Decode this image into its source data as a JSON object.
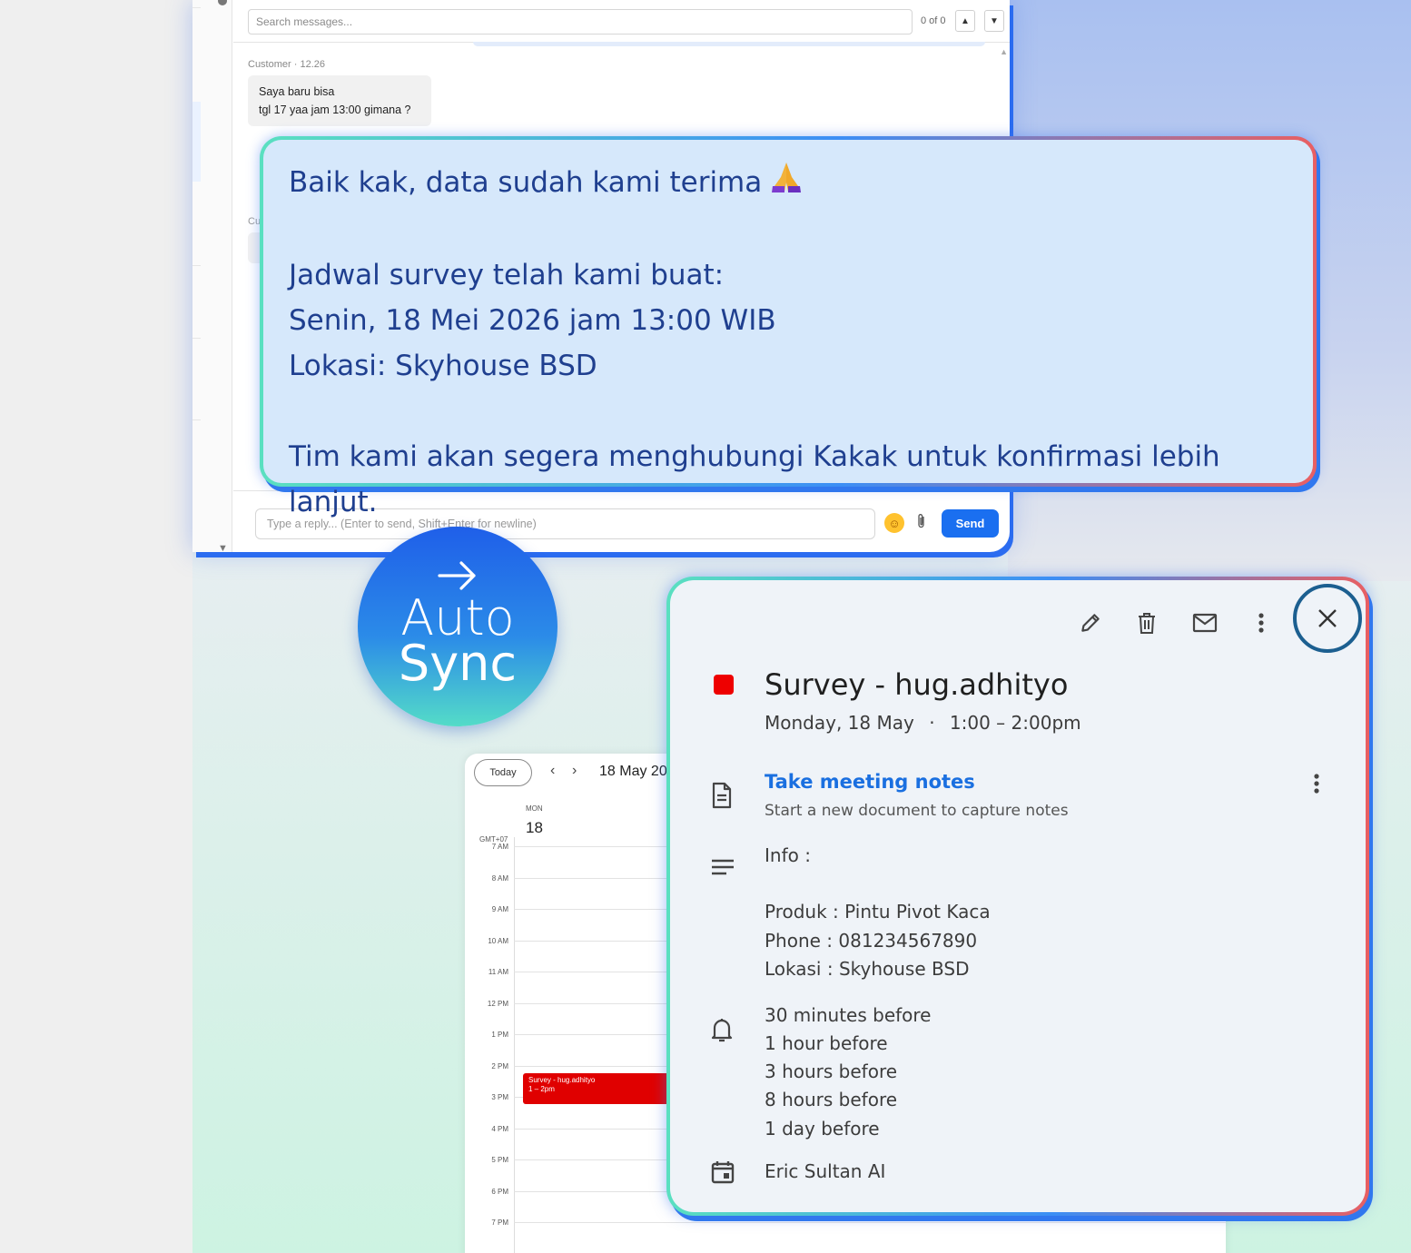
{
  "chat": {
    "search_placeholder": "Search messages...",
    "search_count": "0 of 0",
    "message": {
      "meta": "Customer · 12.26",
      "lines": [
        "Saya baru bisa",
        "tgl 17 yaa jam 13:00 gimana ?"
      ]
    },
    "ghost_meta": "Cu",
    "reply_placeholder": "Type a reply... (Enter to send, Shift+Enter for newline)",
    "send_label": "Send"
  },
  "reply_message": {
    "line1": "Baik kak, data sudah kami terima",
    "line2": "Jadwal survey telah kami buat:",
    "line3": "Senin, 18 Mei 2026 jam 13:00 WIB",
    "line4": "Lokasi: Skyhouse BSD",
    "line5": "Tim kami akan segera menghubungi Kakak untuk konfirmasi lebih lanjut."
  },
  "badge": {
    "word1": "Auto",
    "word2": "Sync"
  },
  "calendar": {
    "today_label": "Today",
    "date_label": "18 May 20",
    "day_of_week": "MON",
    "day_number": "18",
    "timezone": "GMT+07",
    "hours": [
      "7 AM",
      "8 AM",
      "9 AM",
      "10 AM",
      "11 AM",
      "12 PM",
      "1 PM",
      "2 PM",
      "3 PM",
      "4 PM",
      "5 PM",
      "6 PM",
      "7 PM"
    ],
    "event": {
      "title": "Survey - hug.adhityo",
      "time": "1 – 2pm",
      "color": "#e00000"
    }
  },
  "event_detail": {
    "title": "Survey - hug.adhityo",
    "date": "Monday, 18 May",
    "separator": "·",
    "time": "1:00 – 2:00pm",
    "notes_link": "Take meeting notes",
    "notes_sub": "Start a new document to capture notes",
    "info_label": "Info :",
    "info_lines": [
      "Produk : Pintu Pivot Kaca",
      "Phone : 081234567890",
      "Lokasi : Skyhouse BSD"
    ],
    "reminders": [
      "30 minutes before",
      "1 hour before",
      "3 hours before",
      "8 hours before",
      "1 day before"
    ],
    "owner": "Eric Sultan AI",
    "accent_color": "#1a6fe0"
  }
}
